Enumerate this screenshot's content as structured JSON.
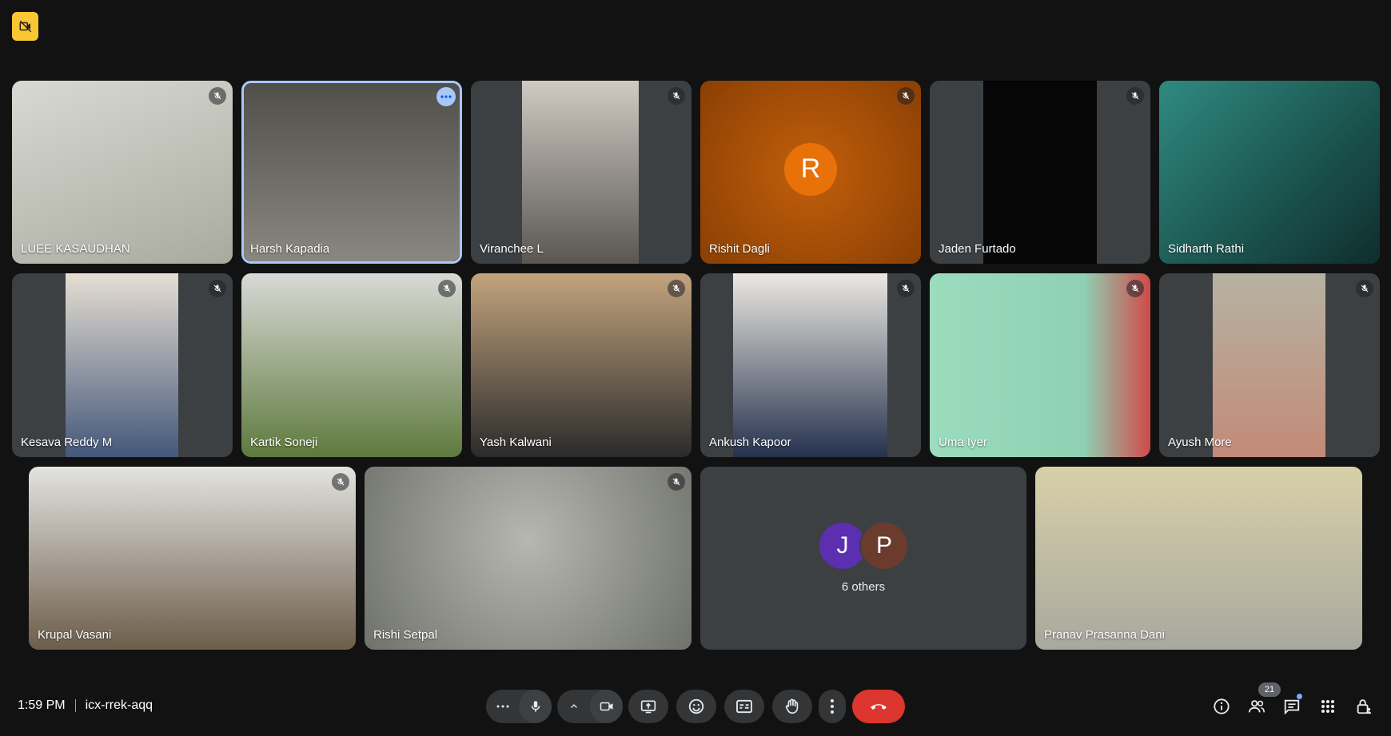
{
  "meeting": {
    "time": "1:59 PM",
    "code": "icx-rrek-aqq"
  },
  "participants": [
    {
      "name": "LUEE KASAUDHAN",
      "muted": true,
      "bg": "#b9bcb2"
    },
    {
      "name": "Harsh Kapadia",
      "muted": false,
      "active": true,
      "bg": "#6f6e69"
    },
    {
      "name": "Viranchee L",
      "muted": true,
      "bg": "#8f8b84"
    },
    {
      "name": "Rishit Dagli",
      "muted": true,
      "avatar_letter": "R",
      "bg": "#b5580a"
    },
    {
      "name": "Jaden Furtado",
      "muted": true,
      "bg": "#070707"
    },
    {
      "name": "Sidharth Rathi",
      "muted": true,
      "bg": "#1f5d59"
    },
    {
      "name": "Kesava Reddy M",
      "muted": true,
      "bg": "#a8a49a"
    },
    {
      "name": "Kartik Soneji",
      "muted": true,
      "bg": "#8a8b85"
    },
    {
      "name": "Yash Kalwani",
      "muted": true,
      "bg": "#9b8469"
    },
    {
      "name": "Ankush Kapoor",
      "muted": true,
      "bg": "#cfcbc2"
    },
    {
      "name": "Uma Iyer",
      "muted": true,
      "bg": "#7fbda3"
    },
    {
      "name": "Ayush More",
      "muted": true,
      "bg": "#9f9a8b"
    },
    {
      "name": "Krupal Vasani",
      "muted": true,
      "bg": "#b8b8b2"
    },
    {
      "name": "Rishi Setpal",
      "muted": true,
      "bg": "#8f928a"
    },
    {
      "name": "Pranav Prasanna Dani",
      "muted": false,
      "bg": "#c4bf9e"
    }
  ],
  "others_tile": {
    "avatars": [
      {
        "letter": "J",
        "color": "#5b2fb0"
      },
      {
        "letter": "P",
        "color": "#6b3b2e"
      }
    ],
    "label": "6 others"
  },
  "controls": {
    "participants_count": "21",
    "accent_end_call": "#dc362e"
  }
}
